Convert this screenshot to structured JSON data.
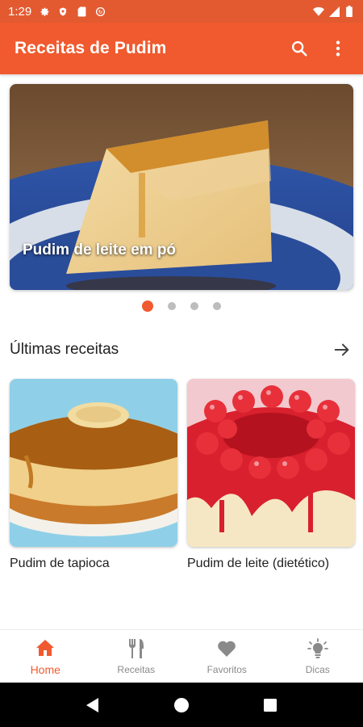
{
  "status_bar": {
    "time": "1:29",
    "icons": [
      "gear-icon",
      "shield-icon",
      "sd-card-icon",
      "sync-icon",
      "wifi-icon",
      "signal-icon",
      "battery-icon"
    ]
  },
  "app_bar": {
    "title": "Receitas de Pudim",
    "actions": [
      "search-icon",
      "more-vert-icon"
    ]
  },
  "carousel": {
    "slides": [
      {
        "title": "Pudim de leite em pó",
        "image": "pudding-slice-on-blue-plate"
      }
    ],
    "dot_count": 4,
    "active_index": 0
  },
  "latest": {
    "title": "Últimas receitas",
    "more_icon": "arrow-right-icon",
    "items": [
      {
        "title": "Pudim de tapioca",
        "image": "caramel-ring-pudding"
      },
      {
        "title": "Pudim de leite (dietético)",
        "image": "pudding-with-red-cherries"
      }
    ]
  },
  "bottom_nav": {
    "items": [
      {
        "label": "Home",
        "icon": "home-icon",
        "active": true
      },
      {
        "label": "Receitas",
        "icon": "fork-knife-icon",
        "active": false
      },
      {
        "label": "Favoritos",
        "icon": "heart-icon",
        "active": false
      },
      {
        "label": "Dicas",
        "icon": "lightbulb-icon",
        "active": false
      }
    ]
  },
  "colors": {
    "primary": "#f05a2e",
    "status_bar": "#e35a31",
    "inactive": "#8a8a8a"
  }
}
